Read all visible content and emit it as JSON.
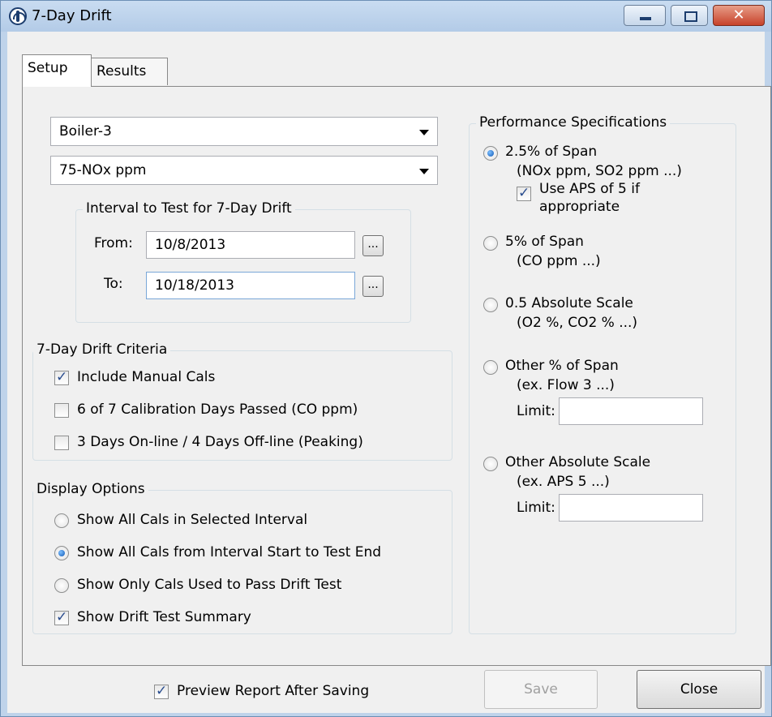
{
  "window": {
    "title": "7-Day Drift"
  },
  "tabs": {
    "setup": "Setup",
    "results": "Results"
  },
  "unit_select": {
    "value": "Boiler-3"
  },
  "parameter_select": {
    "value": "75-NOx ppm"
  },
  "interval": {
    "title": "Interval to Test for 7-Day Drift",
    "from_label": "From:",
    "from_value": "10/8/2013",
    "to_label": "To:",
    "to_value": "10/18/2013",
    "browse_label": "..."
  },
  "criteria": {
    "title": "7-Day Drift Criteria",
    "items": [
      {
        "label": "Include Manual Cals",
        "checked": true
      },
      {
        "label": "6 of 7 Calibration Days Passed (CO ppm)",
        "checked": false
      },
      {
        "label": "3 Days On-line / 4 Days Off-line (Peaking)",
        "checked": false
      }
    ]
  },
  "display": {
    "title": "Display Options",
    "radios": [
      {
        "label": "Show All Cals in Selected Interval",
        "selected": false
      },
      {
        "label": "Show All Cals from Interval Start to Test End",
        "selected": true
      },
      {
        "label": "Show Only Cals Used to Pass Drift Test",
        "selected": false
      }
    ],
    "summary": {
      "label": "Show Drift Test Summary",
      "checked": true
    }
  },
  "performance": {
    "title": "Performance Specifications",
    "options": [
      {
        "label": "2.5% of Span",
        "sub": "(NOx ppm, SO2 ppm ...)",
        "selected": true
      },
      {
        "label": "5% of Span",
        "sub": "(CO ppm ...)",
        "selected": false
      },
      {
        "label": "0.5 Absolute Scale",
        "sub": "(O2 %, CO2 % ...)",
        "selected": false
      },
      {
        "label": "Other % of Span",
        "sub": "(ex. Flow  3 ...)",
        "selected": false
      },
      {
        "label": "Other Absolute Scale",
        "sub": "(ex. APS 5 ...)",
        "selected": false
      }
    ],
    "aps_check": {
      "line1": "Use APS of 5 if",
      "line2": "appropriate",
      "checked": true
    },
    "limit_label": "Limit:",
    "other_pct_limit": "",
    "other_abs_limit": ""
  },
  "footer": {
    "preview": {
      "label": "Preview Report After Saving",
      "checked": true
    },
    "save_label": "Save",
    "close_label": "Close"
  }
}
